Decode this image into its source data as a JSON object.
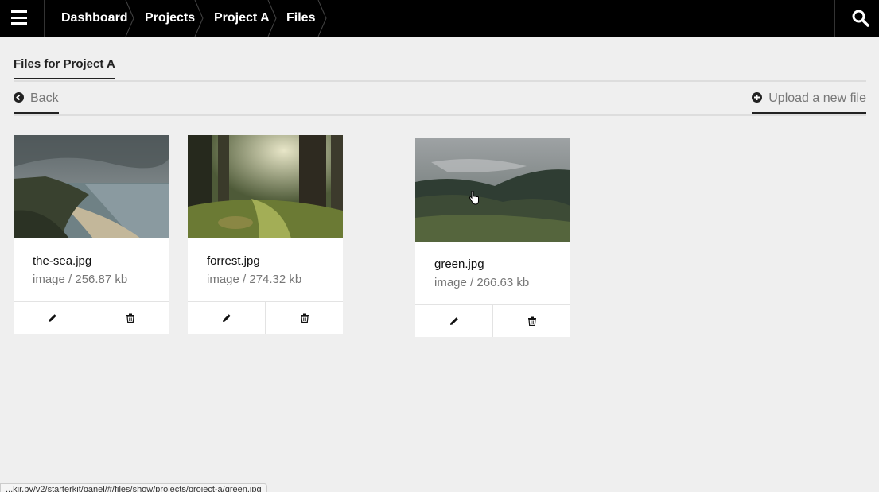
{
  "breadcrumbs": [
    {
      "label": "Dashboard"
    },
    {
      "label": "Projects"
    },
    {
      "label": "Project A"
    },
    {
      "label": "Files"
    }
  ],
  "headline": "Files for Project A",
  "actions": {
    "back_label": "Back",
    "upload_label": "Upload a new file"
  },
  "files": [
    {
      "name": "the-sea.jpg",
      "meta": "image / 256.87 kb"
    },
    {
      "name": "forrest.jpg",
      "meta": "image / 274.32 kb"
    },
    {
      "name": "green.jpg",
      "meta": "image / 266.63 kb"
    }
  ],
  "status_url": "...kir.by/v2/starterkit/panel/#/files/show/projects/project-a/green.jpg",
  "icons": {
    "menu": "hamburger-icon",
    "search": "search-icon",
    "back": "arrow-left-circle-icon",
    "upload": "plus-circle-icon",
    "edit": "pencil-icon",
    "delete": "trash-icon"
  },
  "colors": {
    "topbar": "#000000",
    "background": "#efefef",
    "muted_text": "#777777"
  }
}
